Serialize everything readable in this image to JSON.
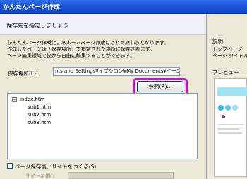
{
  "window": {
    "title": "かんたんページ作成"
  },
  "header": {
    "text": "保存先を指定しましょう"
  },
  "intro": {
    "lines": [
      "かんたんページ作成によるホームページ作成はこれで終わりとなります。",
      "作成したページは「保存場所」で指定された場所に保存されます。",
      "ページ編集領域で後から自由に編集することができます。"
    ]
  },
  "location": {
    "label": "保存場所(L):",
    "value": "nts and Settings¥イプシロン¥My Documents¥イーエルワークス"
  },
  "browse": {
    "label": "参照(R)..."
  },
  "tree": {
    "root": "index.htm",
    "children": [
      "sub1.htm",
      "sub2.htm",
      "sub3.htm"
    ],
    "expander": "−"
  },
  "options": {
    "create_site_label": "ページ保存後、サイトをつくる(S)"
  },
  "site": {
    "name_label": "サイト名(N):"
  },
  "right_panel": {
    "explain_title": "説明",
    "explain_lines": [
      "トップページ",
      "ページ タイトル"
    ],
    "preview_title": "プレビュー"
  },
  "preview": {
    "colors": {
      "banner": "#9fe3f6",
      "dot1": "#33b7d9",
      "dot2": "#66c9e3",
      "dot3": "#9fdcec",
      "dot4": "#7c2fb0"
    }
  }
}
